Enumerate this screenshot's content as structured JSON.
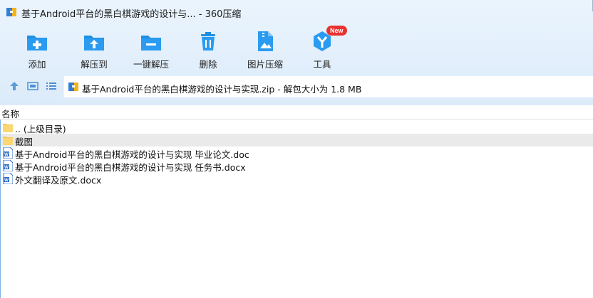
{
  "window": {
    "title": "基于Android平台的黑白棋游戏的设计与... - 360压缩"
  },
  "toolbar": [
    {
      "label": "添加",
      "icon": "add-icon"
    },
    {
      "label": "解压到",
      "icon": "extract-to-icon"
    },
    {
      "label": "一键解压",
      "icon": "one-click-extract-icon"
    },
    {
      "label": "删除",
      "icon": "delete-icon"
    },
    {
      "label": "图片压缩",
      "icon": "image-compress-icon"
    },
    {
      "label": "工具",
      "icon": "tools-icon",
      "badge": "New"
    }
  ],
  "address": {
    "path": "基于Android平台的黑白棋游戏的设计与实现.zip - 解包大小为 1.8 MB"
  },
  "list": {
    "column_name": "名称",
    "items": [
      {
        "name": ".. (上级目录)",
        "icon": "folder-icon",
        "selected": false
      },
      {
        "name": "截图",
        "icon": "folder-icon",
        "selected": true
      },
      {
        "name": "基于Android平台的黑白棋游戏的设计与实现 毕业论文.doc",
        "icon": "word-doc-icon",
        "selected": false
      },
      {
        "name": "基于Android平台的黑白棋游戏的设计与实现 任务书.docx",
        "icon": "word-doc-icon",
        "selected": false
      },
      {
        "name": "外文翻译及原文.docx",
        "icon": "word-doc-icon",
        "selected": false
      }
    ]
  },
  "colors": {
    "accent": "#1e8fe0",
    "badge": "#e8322f",
    "toolbar_bg": "#e4f0fc"
  }
}
